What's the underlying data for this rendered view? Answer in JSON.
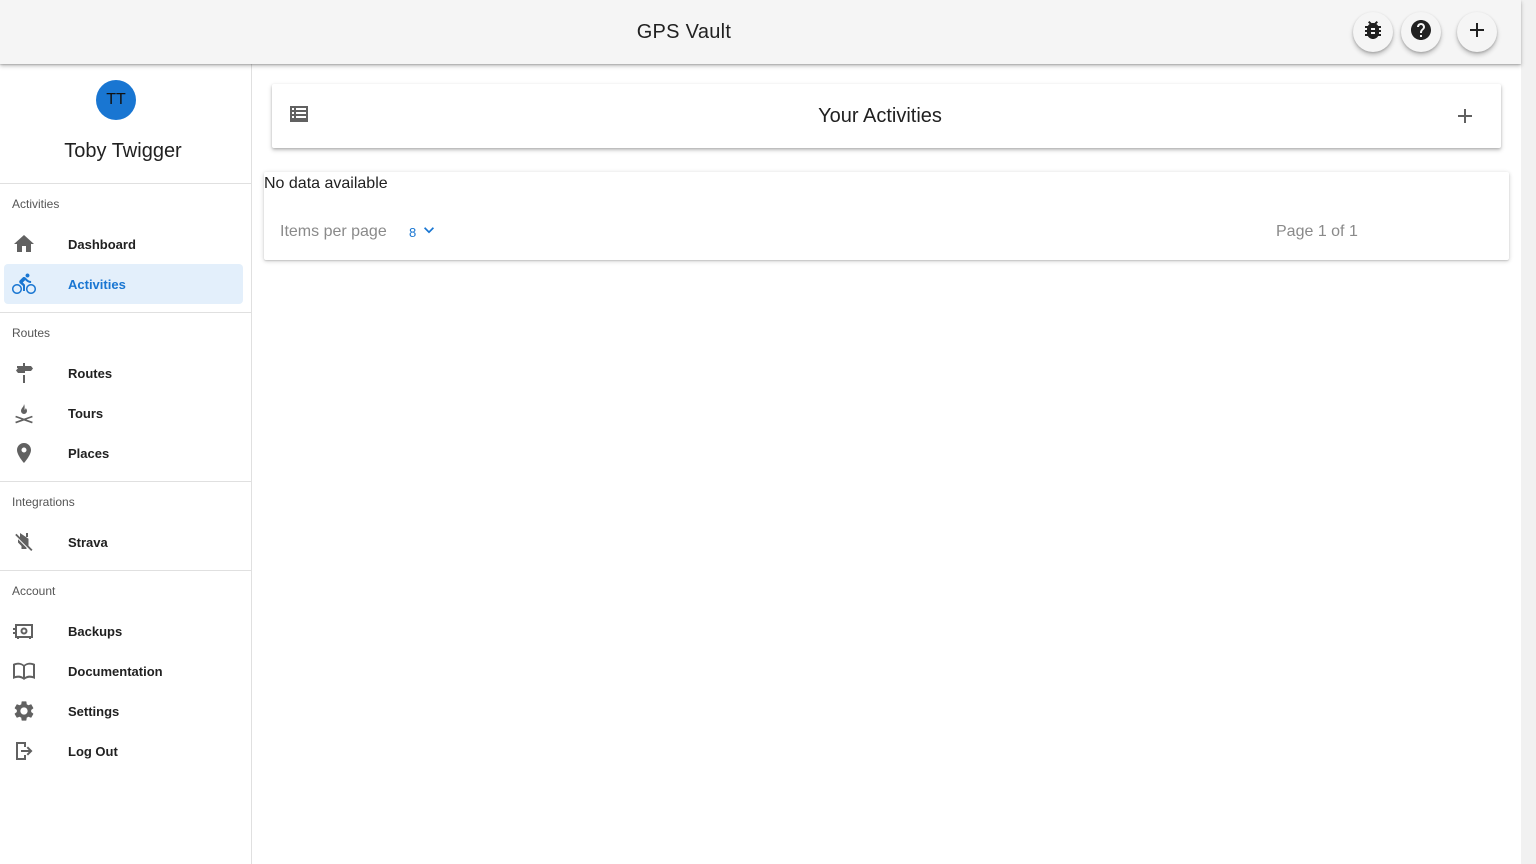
{
  "appbar": {
    "title": "GPS Vault",
    "buttons": [
      {
        "name": "bug-report-button",
        "icon": "bug-icon"
      },
      {
        "name": "help-button",
        "icon": "help-icon"
      },
      {
        "name": "add-button",
        "icon": "plus-icon"
      }
    ]
  },
  "profile": {
    "initials": "TT",
    "name": "Toby Twigger",
    "avatar_color": "#1976d2"
  },
  "sidebar": {
    "sections": [
      {
        "header": "Activities",
        "items": [
          {
            "label": "Dashboard",
            "icon": "home-icon"
          },
          {
            "label": "Activities",
            "icon": "bike-icon",
            "active": true
          }
        ]
      },
      {
        "header": "Routes",
        "items": [
          {
            "label": "Routes",
            "icon": "signpost-icon"
          },
          {
            "label": "Tours",
            "icon": "campfire-icon"
          },
          {
            "label": "Places",
            "icon": "map-marker-icon"
          }
        ]
      },
      {
        "header": "Integrations",
        "items": [
          {
            "label": "Strava",
            "icon": "power-plug-off-icon"
          }
        ]
      },
      {
        "header": "Account",
        "items": [
          {
            "label": "Backups",
            "icon": "safe-icon"
          },
          {
            "label": "Documentation",
            "icon": "book-open-icon"
          },
          {
            "label": "Settings",
            "icon": "gear-icon"
          },
          {
            "label": "Log Out",
            "icon": "logout-icon"
          }
        ]
      }
    ]
  },
  "main": {
    "card_title": "Your Activities",
    "no_data": "No data available",
    "items_per_page_label": "Items per page",
    "items_per_page_value": "8",
    "page_info": "Page 1 of 1"
  },
  "colors": {
    "accent": "#1976d2",
    "active_bg": "#e3effb",
    "appbar_bg": "#f5f5f5"
  }
}
